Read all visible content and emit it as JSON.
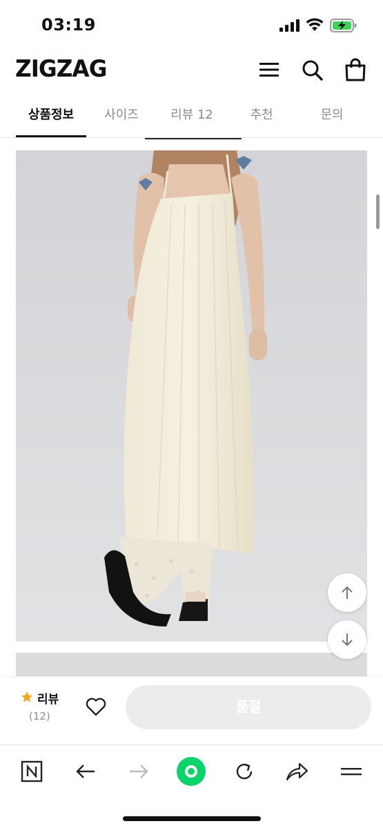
{
  "status_bar": {
    "time": "03:19"
  },
  "header": {
    "logo": "ZIGZAG",
    "icons": [
      "menu-icon",
      "search-icon",
      "shopping-bag-icon"
    ]
  },
  "tabs": [
    {
      "label": "상품정보",
      "active": true
    },
    {
      "label": "사이즈",
      "active": false
    },
    {
      "label": "리뷰 12",
      "active": false
    },
    {
      "label": "추천",
      "active": false
    },
    {
      "label": "문의",
      "active": false
    }
  ],
  "product_image": {
    "description_icon": "product-photo"
  },
  "scroll_buttons": {
    "up_icon": "arrow-up-icon",
    "down_icon": "arrow-down-icon"
  },
  "purchase_bar": {
    "review_label": "리뷰",
    "review_count": "(12)",
    "sold_out_label": "품절"
  },
  "browser_toolbar": {
    "icons": [
      "naver-n-icon",
      "back-arrow-icon",
      "forward-arrow-icon",
      "green-home-icon",
      "reload-icon",
      "share-icon",
      "menu-lines-icon"
    ]
  },
  "colors": {
    "accent_star": "#f2a516",
    "green": "#08d46a",
    "soldout_bg": "#ececed"
  }
}
